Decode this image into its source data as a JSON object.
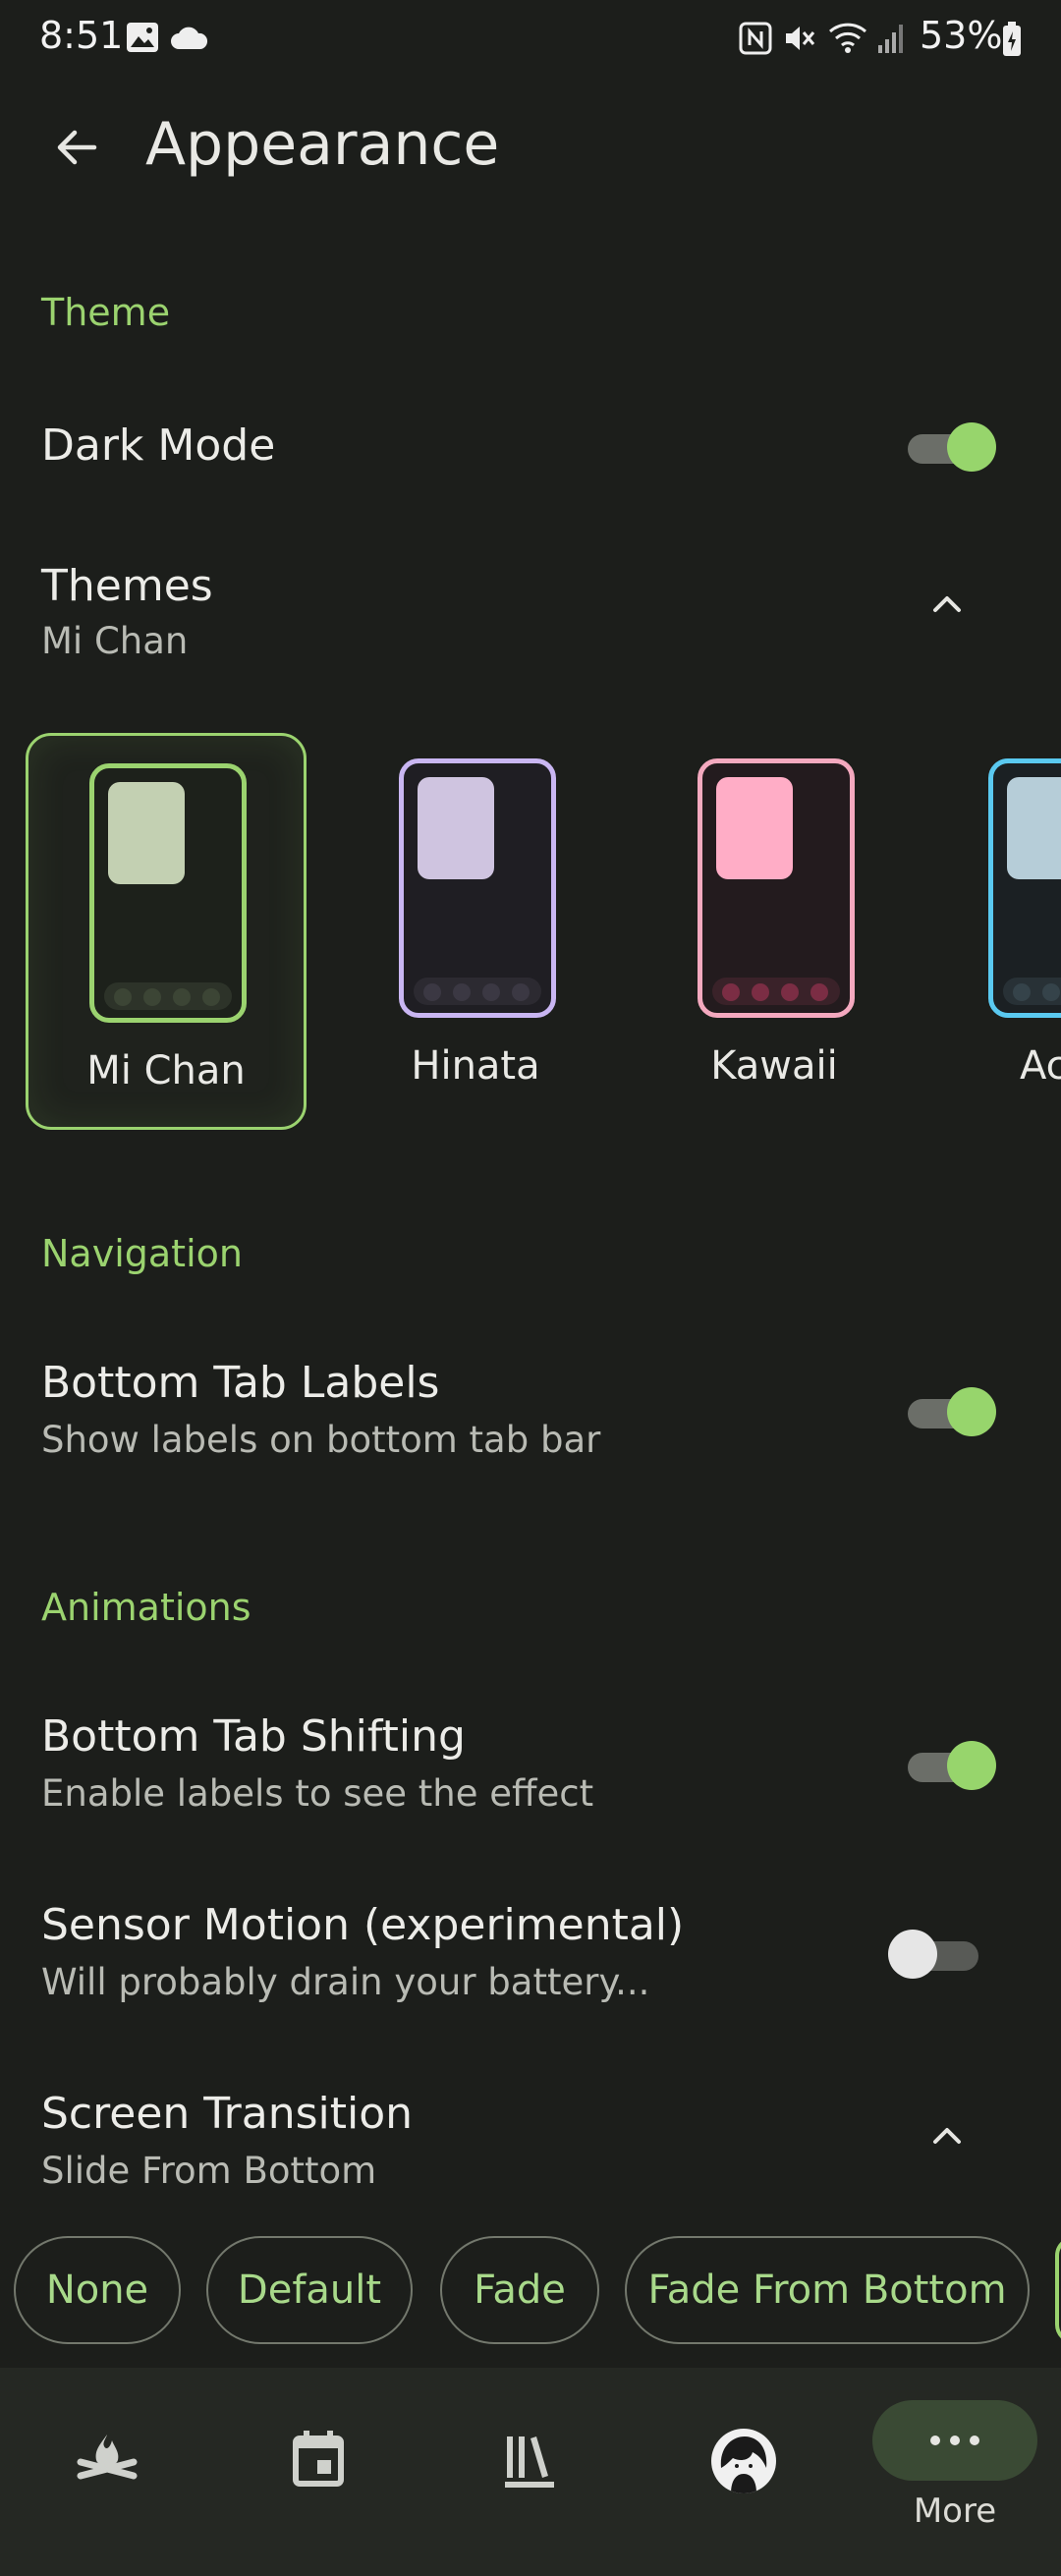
{
  "status_bar": {
    "time": "8:51",
    "battery": "53%"
  },
  "header": {
    "title": "Appearance"
  },
  "sections": {
    "theme": "Theme",
    "navigation": "Navigation",
    "animations": "Animations"
  },
  "dark_mode": {
    "label": "Dark Mode",
    "enabled": true
  },
  "themes": {
    "label": "Themes",
    "value": "Mi Chan",
    "items": [
      {
        "name": "Mi Chan",
        "accent": "#9bd36f",
        "block": "#c3d0b2",
        "dots": "#3c4535",
        "bg": "#1d211b"
      },
      {
        "name": "Hinata",
        "accent": "#c9b6f2",
        "block": "#cfc4e0",
        "dots": "#3b3843",
        "bg": "#1f1e23"
      },
      {
        "name": "Kawaii",
        "accent": "#f4a9bf",
        "block": "#ffadc6",
        "dots": "#7b2d44",
        "bg": "#231b1e"
      },
      {
        "name": "Ac",
        "accent": "#5ac9f0",
        "block": "#b6cdd8",
        "dots": "#35434a",
        "bg": "#1b2023"
      }
    ]
  },
  "bottom_tab_labels": {
    "label": "Bottom Tab Labels",
    "sub": "Show labels on bottom tab bar",
    "enabled": true
  },
  "bottom_tab_shifting": {
    "label": "Bottom Tab Shifting",
    "sub": "Enable labels to see the effect",
    "enabled": true
  },
  "sensor_motion": {
    "label": "Sensor Motion (experimental)",
    "sub": "Will probably drain your battery...",
    "enabled": false
  },
  "screen_transition": {
    "label": "Screen Transition",
    "value": "Slide From Bottom",
    "options": [
      "None",
      "Default",
      "Fade",
      "Fade From Bottom"
    ]
  },
  "bottom_nav": {
    "items": [
      {
        "icon": "campfire-icon"
      },
      {
        "icon": "calendar-icon"
      },
      {
        "icon": "library-icon"
      },
      {
        "icon": "avatar"
      },
      {
        "icon": "more-icon",
        "label": "More"
      }
    ]
  }
}
